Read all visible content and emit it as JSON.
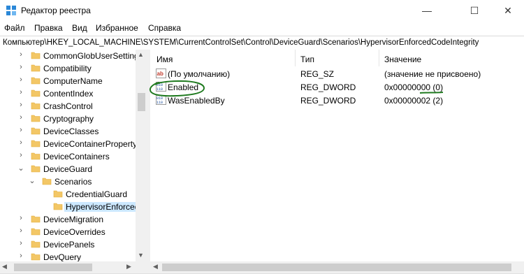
{
  "window": {
    "title": "Редактор реестра",
    "minimize": "—",
    "maximize": "☐",
    "close": "✕"
  },
  "menu": [
    "Файл",
    "Правка",
    "Вид",
    "Избранное",
    "Справка"
  ],
  "address": "Компьютер\\HKEY_LOCAL_MACHINE\\SYSTEM\\CurrentControlSet\\Control\\DeviceGuard\\Scenarios\\HypervisorEnforcedCodeIntegrity",
  "tree": [
    {
      "label": "CommonGlobUserSettings",
      "chevron": "›",
      "level": 0
    },
    {
      "label": "Compatibility",
      "chevron": "›",
      "level": 0
    },
    {
      "label": "ComputerName",
      "chevron": "›",
      "level": 0
    },
    {
      "label": "ContentIndex",
      "chevron": "›",
      "level": 0
    },
    {
      "label": "CrashControl",
      "chevron": "›",
      "level": 0
    },
    {
      "label": "Cryptography",
      "chevron": "›",
      "level": 0
    },
    {
      "label": "DeviceClasses",
      "chevron": "›",
      "level": 0
    },
    {
      "label": "DeviceContainerPropertyUpdateEvents",
      "chevron": "›",
      "level": 0
    },
    {
      "label": "DeviceContainers",
      "chevron": "›",
      "level": 0
    },
    {
      "label": "DeviceGuard",
      "chevron": "⌄",
      "level": 0
    },
    {
      "label": "Scenarios",
      "chevron": "⌄",
      "level": 1
    },
    {
      "label": "CredentialGuard",
      "chevron": "",
      "level": 2
    },
    {
      "label": "HypervisorEnforcedCodeIntegrity",
      "chevron": "",
      "level": 2,
      "selected": true
    },
    {
      "label": "DeviceMigration",
      "chevron": "›",
      "level": 0
    },
    {
      "label": "DeviceOverrides",
      "chevron": "›",
      "level": 0
    },
    {
      "label": "DevicePanels",
      "chevron": "›",
      "level": 0
    },
    {
      "label": "DevQuery",
      "chevron": "›",
      "level": 0
    }
  ],
  "columns": {
    "name": "Имя",
    "type": "Тип",
    "data": "Значение"
  },
  "values": [
    {
      "name": "(По умолчанию)",
      "type": "REG_SZ",
      "data": "(значение не присвоено)",
      "icon": "string-value-icon"
    },
    {
      "name": "Enabled",
      "type": "REG_DWORD",
      "data": "0x00000000 (0)",
      "icon": "dword-value-icon"
    },
    {
      "name": "WasEnabledBy",
      "type": "REG_DWORD",
      "data": "0x00000002 (2)",
      "icon": "dword-value-icon"
    }
  ],
  "scroll": {
    "up": "▲",
    "down": "▼",
    "left": "◀",
    "right": "▶"
  },
  "colors": {
    "folder": "#f3c766",
    "folder_dark": "#e2aa35",
    "annotation": "#1f7a1f",
    "selection": "#cce8ff"
  }
}
